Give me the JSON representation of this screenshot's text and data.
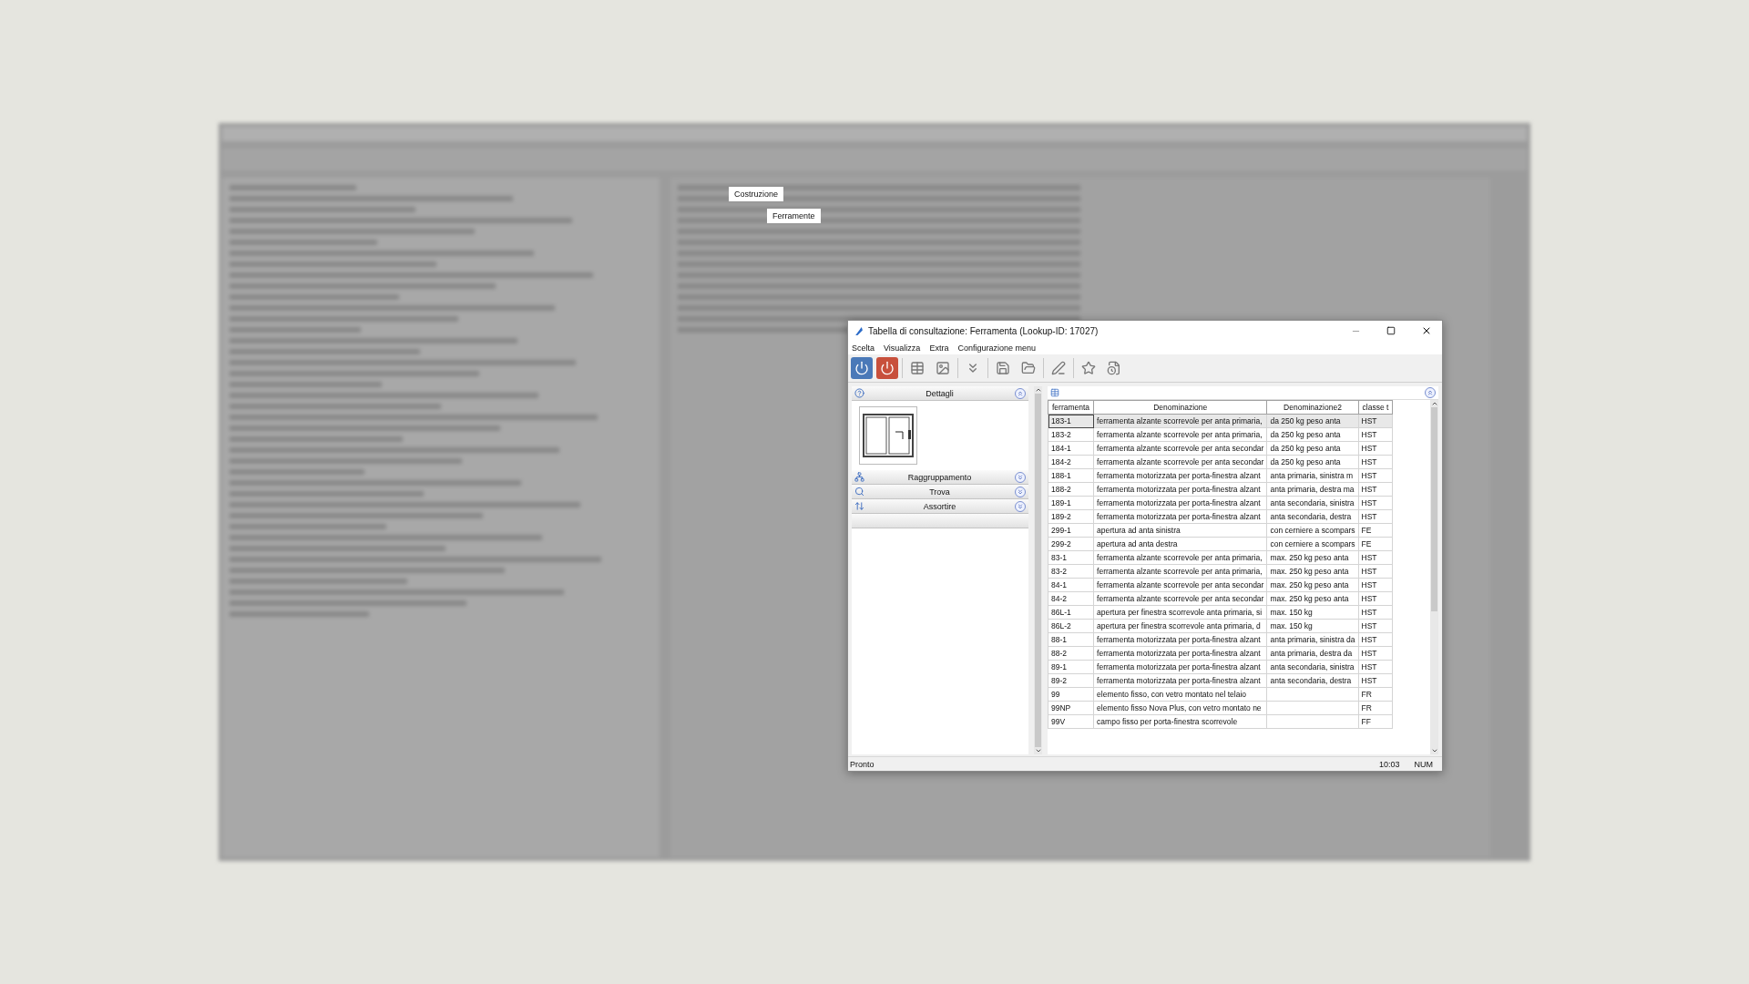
{
  "background_window": {
    "highlighted_labels": [
      "Costruzione",
      "Ferramente"
    ]
  },
  "dialog": {
    "title": "Tabella di consultazione: Ferramenta (Lookup-ID: 17027)",
    "menu": [
      "Scelta",
      "Visualizza",
      "Extra",
      "Configurazione menu"
    ],
    "sections": [
      {
        "label": "Dettagli",
        "expanded": true
      },
      {
        "label": "Raggruppamento",
        "expanded": false
      },
      {
        "label": "Trova",
        "expanded": false
      },
      {
        "label": "Assortire",
        "expanded": false
      }
    ],
    "table": {
      "columns": [
        "ferramenta",
        "Denominazione",
        "Denominazione2",
        "classe t"
      ],
      "rows": [
        {
          "cells": [
            "183-1",
            "ferramenta alzante scorrevole per anta primaria,",
            "da 250 kg peso anta",
            "HST"
          ],
          "selected": true
        },
        {
          "cells": [
            "183-2",
            "ferramenta alzante scorrevole per anta primaria,",
            "da 250 kg peso anta",
            "HST"
          ],
          "selected": false
        },
        {
          "cells": [
            "184-1",
            "ferramenta alzante scorrevole per anta secondar",
            "da 250 kg peso anta",
            "HST"
          ],
          "selected": false
        },
        {
          "cells": [
            "184-2",
            "ferramenta alzante scorrevole per anta secondar",
            "da 250 kg peso anta",
            "HST"
          ],
          "selected": false
        },
        {
          "cells": [
            "188-1",
            "ferramenta motorizzata per porta-finestra alzant",
            "anta primaria, sinistra m",
            "HST"
          ],
          "selected": false
        },
        {
          "cells": [
            "188-2",
            "ferramenta motorizzata per porta-finestra alzant",
            "anta primaria, destra ma",
            "HST"
          ],
          "selected": false
        },
        {
          "cells": [
            "189-1",
            "ferramenta motorizzata per porta-finestra alzant",
            "anta secondaria, sinistra",
            "HST"
          ],
          "selected": false
        },
        {
          "cells": [
            "189-2",
            "ferramenta motorizzata per porta-finestra alzant",
            "anta secondaria, destra",
            "HST"
          ],
          "selected": false
        },
        {
          "cells": [
            "299-1",
            "apertura ad anta sinistra",
            "con cerniere a scompars",
            "FE"
          ],
          "selected": false
        },
        {
          "cells": [
            "299-2",
            "apertura ad anta destra",
            "con cerniere a scompars",
            "FE"
          ],
          "selected": false
        },
        {
          "cells": [
            "83-1",
            "ferramenta alzante scorrevole per anta primaria,",
            "max. 250 kg peso anta",
            "HST"
          ],
          "selected": false
        },
        {
          "cells": [
            "83-2",
            "ferramenta alzante scorrevole per anta primaria,",
            "max. 250 kg peso anta",
            "HST"
          ],
          "selected": false
        },
        {
          "cells": [
            "84-1",
            "ferramenta alzante scorrevole per anta secondar",
            "max. 250 kg peso anta",
            "HST"
          ],
          "selected": false
        },
        {
          "cells": [
            "84-2",
            "ferramenta alzante scorrevole per anta secondar",
            "max. 250 kg peso anta",
            "HST"
          ],
          "selected": false
        },
        {
          "cells": [
            "86L-1",
            "apertura per finestra scorrevole anta primaria, si",
            "max. 150 kg",
            "HST"
          ],
          "selected": false
        },
        {
          "cells": [
            "86L-2",
            "apertura per finestra scorrevole anta primaria, d",
            "max. 150 kg",
            "HST"
          ],
          "selected": false
        },
        {
          "cells": [
            "88-1",
            "ferramenta motorizzata per porta-finestra alzant",
            "anta primaria, sinistra da",
            "HST"
          ],
          "selected": false
        },
        {
          "cells": [
            "88-2",
            "ferramenta motorizzata per porta-finestra alzant",
            "anta primaria, destra da",
            "HST"
          ],
          "selected": false
        },
        {
          "cells": [
            "89-1",
            "ferramenta motorizzata per porta-finestra alzant",
            "anta secondaria, sinistra",
            "HST"
          ],
          "selected": false
        },
        {
          "cells": [
            "89-2",
            "ferramenta motorizzata per porta-finestra alzant",
            "anta secondaria, destra",
            "HST"
          ],
          "selected": false
        },
        {
          "cells": [
            "99",
            "elemento fisso, con vetro montato nel telaio",
            "",
            "FR"
          ],
          "selected": false
        },
        {
          "cells": [
            "99NP",
            "elemento fisso Nova Plus, con vetro montato ne",
            "",
            "FR"
          ],
          "selected": false
        },
        {
          "cells": [
            "99V",
            "campo fisso per porta-finestra scorrevole",
            "",
            "FF"
          ],
          "selected": false
        }
      ]
    },
    "status_bar": {
      "message": "Pronto",
      "time": "10:03",
      "mode": "NUM"
    }
  }
}
